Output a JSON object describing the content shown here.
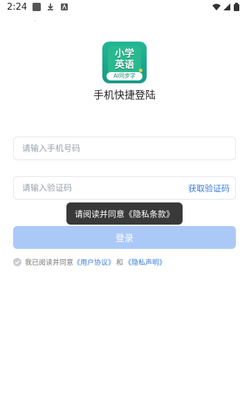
{
  "status": {
    "time": "2:24",
    "left_icons": [
      "square-app-icon",
      "download-icon",
      "translate-icon"
    ],
    "right_icons": [
      "wifi-icon",
      "signal-icon",
      "battery-icon"
    ]
  },
  "logo": {
    "line1": "小学",
    "line2": "英语",
    "sub": "AI同步学"
  },
  "title": "手机快捷登陆",
  "phone": {
    "placeholder": "请输入手机号码"
  },
  "code": {
    "placeholder": "请输入验证码",
    "get_code": "获取验证码"
  },
  "toast": "请阅读并同意《隐私条款》",
  "login_label": "登录",
  "agreement": {
    "prefix": "我已阅读并同意",
    "user_link": "《用户协议》",
    "and": "和",
    "privacy_link": "《隐私声明》"
  },
  "colors": {
    "accent": "#3a7bdc",
    "login_bg": "#abc9f7",
    "logo_green": "#22b795",
    "toast_bg": "#282828"
  }
}
